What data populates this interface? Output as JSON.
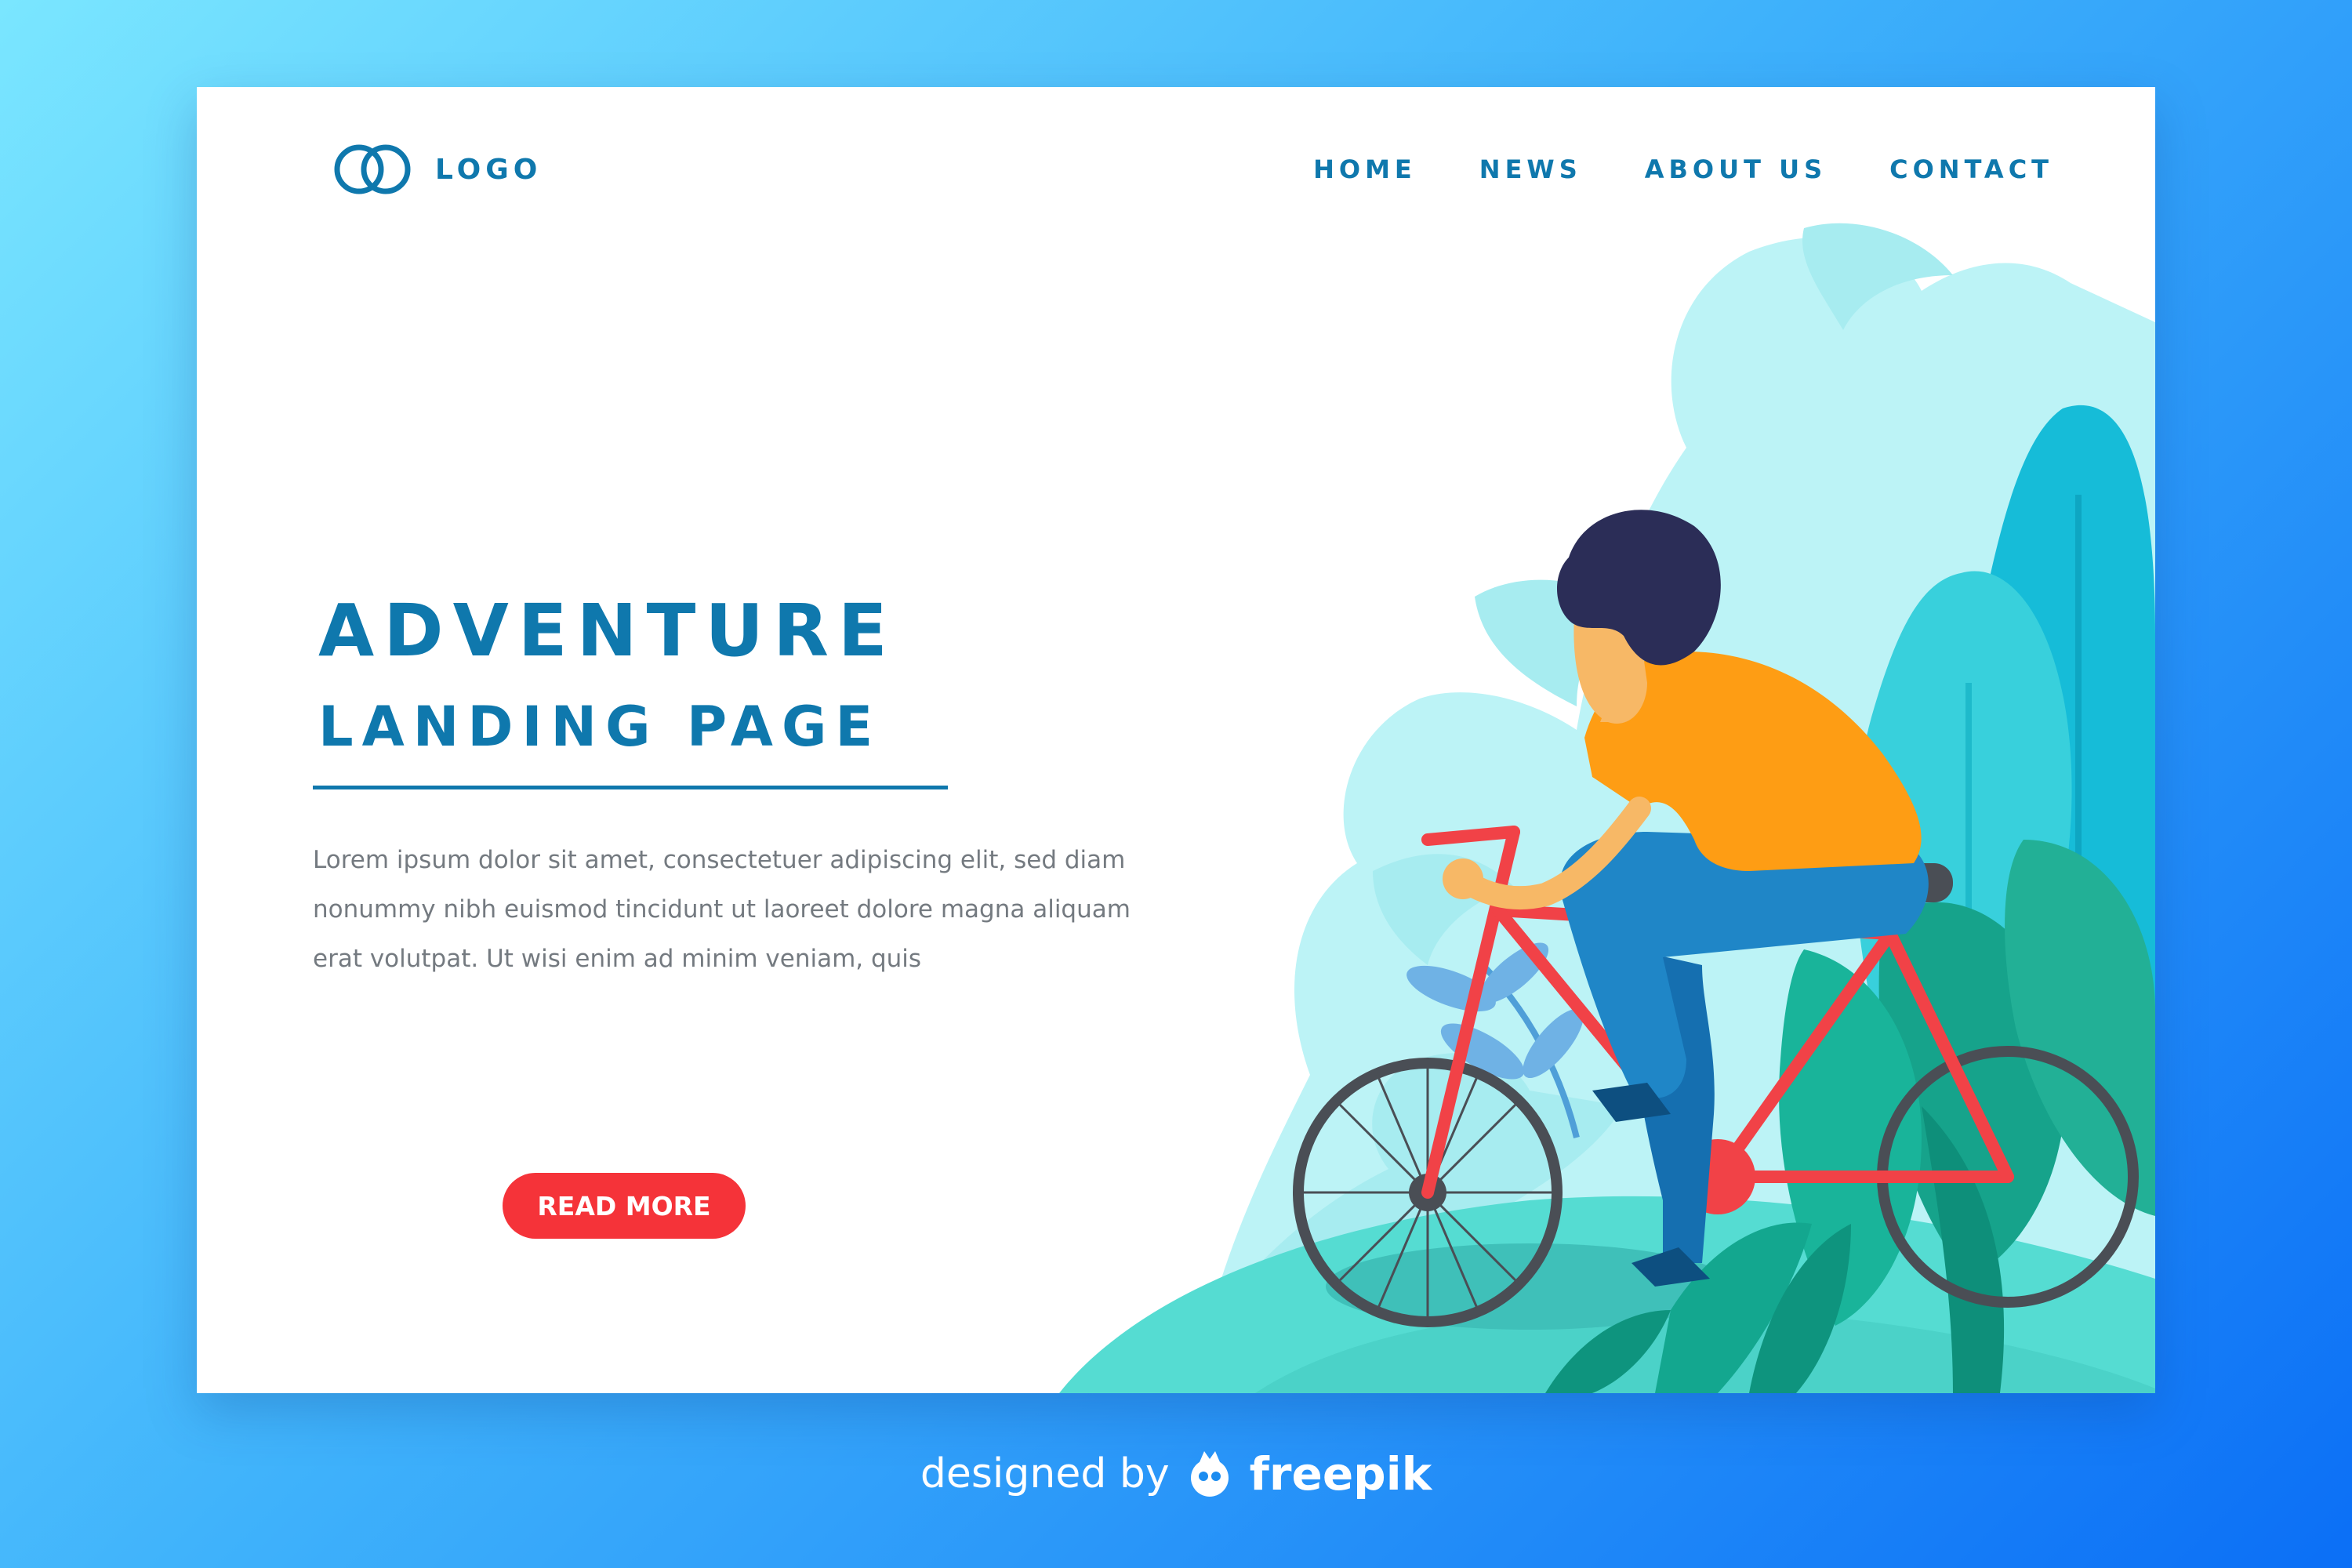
{
  "header": {
    "logo_icon": "interlocked-rings-icon",
    "logo_text": "LOGO",
    "nav": [
      "HOME",
      "NEWS",
      "ABOUT US",
      "CONTACT"
    ]
  },
  "hero": {
    "title_line1": "ADVENTURE",
    "title_line2": "LANDING PAGE",
    "body": "Lorem ipsum dolor sit amet, consectetuer adipiscing elit, sed diam nonummy nibh euismod tincidunt ut laoreet dolore magna aliquam erat volutpat. Ut wisi enim ad minim veniam, quis",
    "cta_label": "READ MORE"
  },
  "illustration": {
    "subject": "person-riding-bicycle"
  },
  "footer": {
    "credit_prefix": "designed by",
    "credit_brand": "freepik",
    "credit_icon": "freepik-mascot-icon"
  },
  "colors": {
    "accent": "#0f78ad",
    "cta": "#f53339",
    "body_text": "#747a80",
    "background_start": "#7ae6ff",
    "background_end": "#0b6ff6"
  }
}
